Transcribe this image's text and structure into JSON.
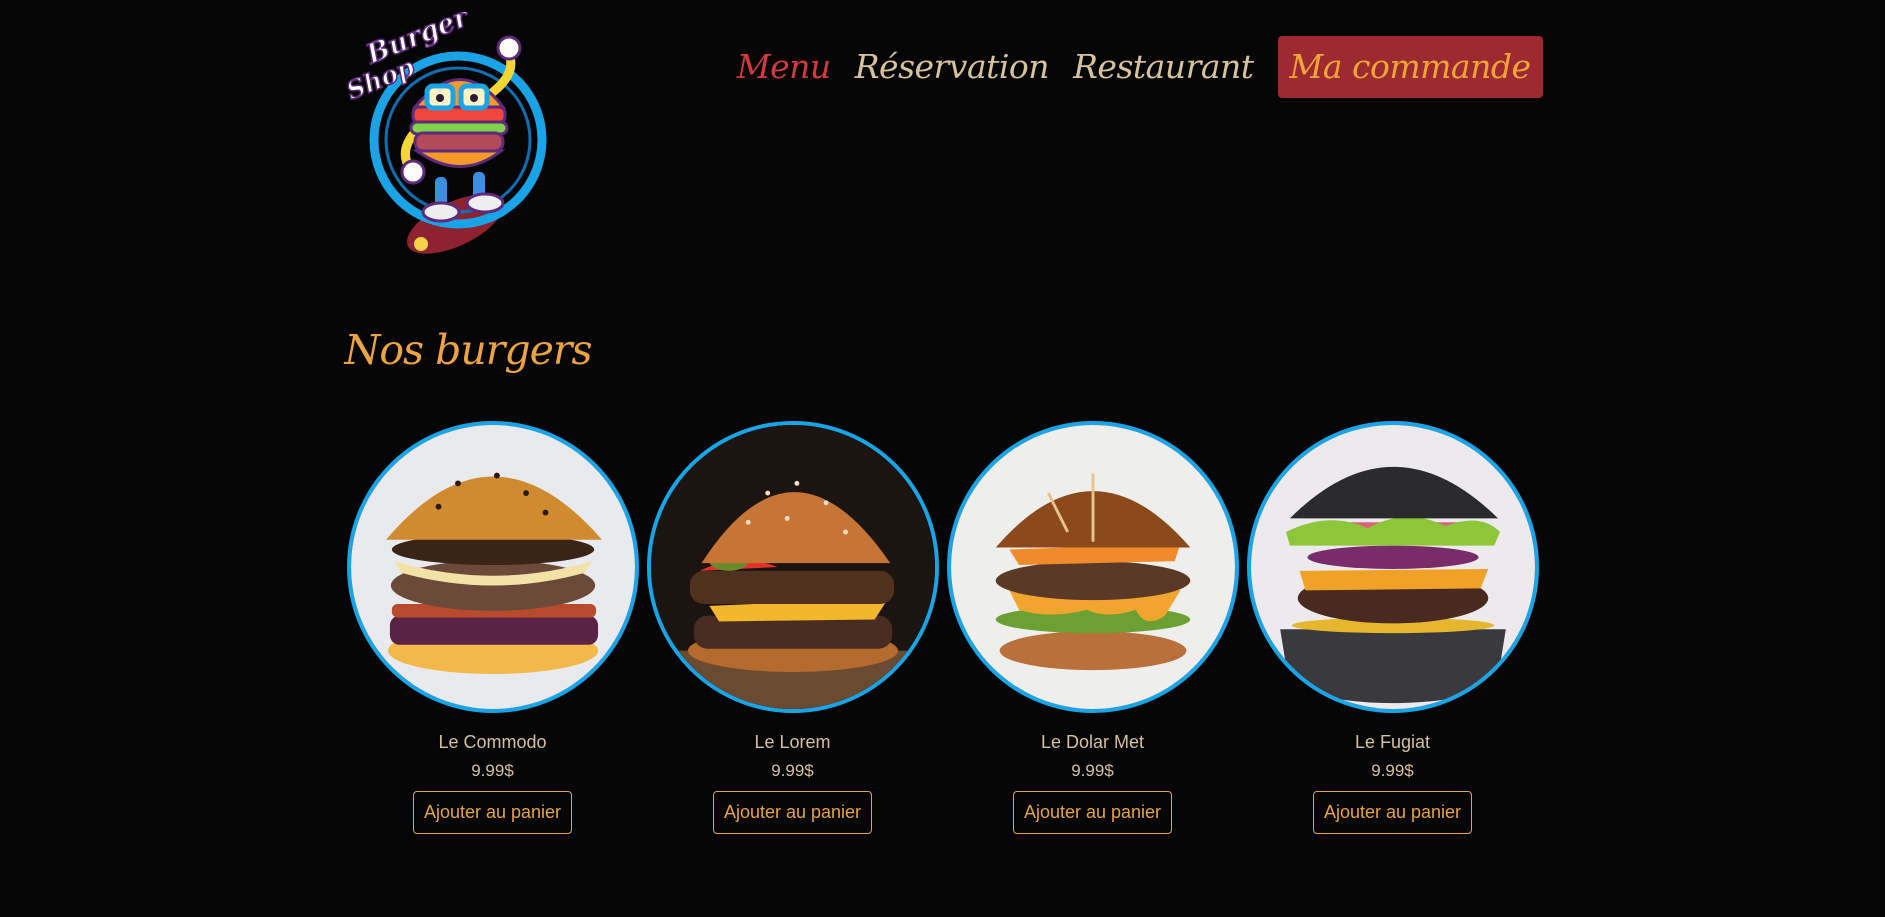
{
  "brand": {
    "logo_text_line1": "Burger",
    "logo_text_line2": "Shop",
    "logo_icon": "burger-mascot-skateboard-logo"
  },
  "nav": {
    "items": [
      {
        "label": "Menu",
        "active": true
      },
      {
        "label": "Réservation",
        "active": false
      },
      {
        "label": "Restaurant",
        "active": false
      }
    ],
    "cart_label": "Ma commande"
  },
  "section": {
    "title": "Nos burgers"
  },
  "products": [
    {
      "name": "Le Commodo",
      "price": "9.99$",
      "button": "Ajouter au panier"
    },
    {
      "name": "Le Lorem",
      "price": "9.99$",
      "button": "Ajouter au panier"
    },
    {
      "name": "Le Dolar Met",
      "price": "9.99$",
      "button": "Ajouter au panier"
    },
    {
      "name": "Le Fugiat",
      "price": "9.99$",
      "button": "Ajouter au panier"
    }
  ],
  "colors": {
    "background": "#060505",
    "accent_orange": "#eea342",
    "accent_red": "#d13a3f",
    "cart_bg": "#9e2a31",
    "circle_border": "#18a5e8",
    "nav_text": "#d6c39c"
  }
}
